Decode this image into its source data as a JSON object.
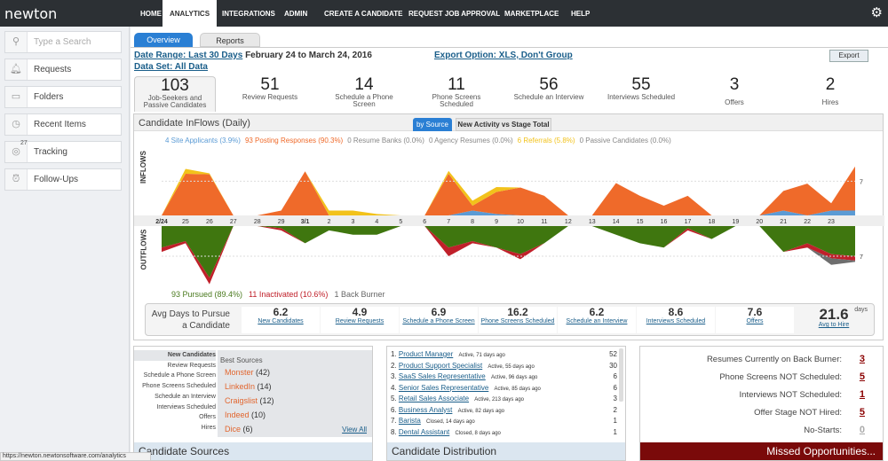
{
  "nav": {
    "logo": "newton",
    "items": [
      "HOME",
      "ANALYTICS",
      "INTEGRATIONS",
      "ADMIN",
      "CREATE A CANDIDATE",
      "REQUEST JOB APPROVAL",
      "MARKETPLACE",
      "HELP"
    ],
    "active": "ANALYTICS"
  },
  "sidebar": {
    "search_placeholder": "Type a Search",
    "items": [
      {
        "label": "Requests",
        "icon": "bell-icon"
      },
      {
        "label": "Folders",
        "icon": "folder-icon"
      },
      {
        "label": "Recent Items",
        "icon": "clock-icon"
      },
      {
        "label": "Tracking",
        "icon": "target-icon",
        "badge": "27"
      },
      {
        "label": "Follow-Ups",
        "icon": "alarm-clock-icon"
      }
    ]
  },
  "tabs": [
    "Overview",
    "Reports"
  ],
  "filters": {
    "date_range_link": "Date Range: Last 30 Days",
    "date_range_text": "February 24 to March 24, 2016",
    "export_option": "Export Option: XLS, Don't Group",
    "data_set": "Data Set: All Data",
    "export_button": "Export"
  },
  "metrics": [
    {
      "value": "103",
      "label": "Job-Seekers and Passive Candidates"
    },
    {
      "value": "51",
      "label": "Review Requests"
    },
    {
      "value": "14",
      "label": "Schedule a Phone Screen"
    },
    {
      "value": "11",
      "label": "Phone Screens Scheduled"
    },
    {
      "value": "56",
      "label": "Schedule an Interview"
    },
    {
      "value": "55",
      "label": "Interviews Scheduled"
    },
    {
      "value": "3",
      "label": "Offers"
    },
    {
      "value": "2",
      "label": "Hires"
    }
  ],
  "chart_panel": {
    "title": "Candidate InFlows (Daily)",
    "tabs": [
      "by Source",
      "New Activity vs Stage Total"
    ],
    "inflow_label": "INFLOWS",
    "outflow_label": "OUTFLOWS"
  },
  "chart_data": {
    "type": "area",
    "x": [
      "2/24",
      "25",
      "26",
      "27",
      "28",
      "29",
      "3/1",
      "2",
      "3",
      "4",
      "5",
      "6",
      "7",
      "8",
      "9",
      "10",
      "11",
      "12",
      "13",
      "14",
      "15",
      "16",
      "17",
      "18",
      "19",
      "20",
      "21",
      "22",
      "23",
      ""
    ],
    "inflows": {
      "reference_value": 7,
      "ylim": [
        0,
        10.5
      ],
      "legend": [
        {
          "label": "4 Site Applicants (3.9%)",
          "color": "#5b9bd5"
        },
        {
          "label": "93 Posting Responses (90.3%)",
          "color": "#ef6a2a"
        },
        {
          "label": "0 Resume Banks (0.0%)",
          "color": "#888888"
        },
        {
          "label": "0 Agency Resumes (0.0%)",
          "color": "#888888"
        },
        {
          "label": "6 Referrals (5.8%)",
          "color": "#f2c21b"
        },
        {
          "label": "0 Passive Candidates (0.0%)",
          "color": "#888888"
        }
      ],
      "series": [
        {
          "name": "Site Applicants",
          "color": "#5b9bd5",
          "values": [
            0,
            0,
            0,
            0,
            0,
            0,
            0,
            0,
            0,
            0,
            0,
            0,
            0,
            1,
            0.3,
            0,
            0,
            0,
            0,
            0,
            0,
            0,
            0,
            0,
            0,
            0,
            1,
            0,
            1,
            1
          ]
        },
        {
          "name": "Posting Responses",
          "color": "#ef6a2a",
          "values": [
            0,
            8.5,
            8.4,
            0,
            0,
            1,
            9,
            0,
            0,
            0,
            0,
            0,
            8.5,
            1,
            4.5,
            5.7,
            4,
            0,
            0,
            6.6,
            4,
            2,
            4,
            0,
            0,
            0,
            4,
            6.5,
            1.5,
            9
          ]
        },
        {
          "name": "Referrals",
          "color": "#f2c21b",
          "values": [
            0,
            1,
            0.2,
            0,
            0,
            0,
            0,
            1,
            1,
            0.3,
            0,
            0,
            0.6,
            1,
            1,
            0,
            0,
            0,
            0,
            0,
            0,
            0,
            0,
            0,
            0,
            0,
            0,
            0,
            0,
            0
          ]
        }
      ]
    },
    "outflows": {
      "reference_value": 7,
      "ylim": [
        0,
        14
      ],
      "legend": [
        {
          "label": "93 Pursued (89.4%)",
          "color": "#4a7a1e"
        },
        {
          "label": "11 Inactivated (10.6%)",
          "color": "#c0202a"
        },
        {
          "label": "1 Back Burner",
          "color": "#666666"
        }
      ],
      "series": [
        {
          "name": "Pursued",
          "color": "#3f760f",
          "values": [
            5,
            3.5,
            12,
            0,
            0,
            0.5,
            4,
            1,
            2,
            2,
            0,
            0,
            5,
            3.5,
            5,
            6.5,
            4,
            0,
            0,
            2,
            4,
            5,
            0.5,
            3,
            0,
            0,
            6,
            4,
            6.5,
            7
          ]
        },
        {
          "name": "Inactivated",
          "color": "#c0202a",
          "values": [
            1,
            0.5,
            1.5,
            0,
            0,
            0.5,
            0,
            0,
            0,
            0,
            0,
            0,
            2,
            0.5,
            0,
            1.2,
            0,
            0,
            0,
            0,
            0,
            0,
            0.5,
            0,
            0,
            0,
            0,
            1,
            1,
            1
          ]
        },
        {
          "name": "Back Burner",
          "color": "#6e6e6e",
          "values": [
            0,
            0,
            0,
            0,
            0,
            0,
            0,
            0,
            0,
            0,
            0,
            0,
            0,
            0,
            0,
            0,
            0,
            0,
            0,
            0,
            0,
            0,
            0,
            0,
            0,
            0,
            0,
            0,
            1.5,
            0.3
          ]
        }
      ]
    }
  },
  "avg_days": {
    "title": "Avg Days to Pursue a Candidate",
    "unit": "days",
    "stages": [
      {
        "value": "6.2",
        "label": "New Candidates"
      },
      {
        "value": "4.9",
        "label": "Review Requests"
      },
      {
        "value": "6.9",
        "label": "Schedule a Phone Screen"
      },
      {
        "value": "16.2",
        "label": "Phone Screens Scheduled"
      },
      {
        "value": "6.2",
        "label": "Schedule an Interview"
      },
      {
        "value": "8.6",
        "label": "Interviews Scheduled"
      },
      {
        "value": "7.6",
        "label": "Offers"
      },
      {
        "value": "21.6",
        "label": "Avg to Hire"
      }
    ]
  },
  "sources": {
    "stages": [
      "New Candidates",
      "Review Requests",
      "Schedule a Phone Screen",
      "Phone Screens Scheduled",
      "Schedule an Interview",
      "Interviews Scheduled",
      "Offers",
      "Hires"
    ],
    "best_title": "Best Sources",
    "best": [
      {
        "name": "Monster",
        "count": "(42)"
      },
      {
        "name": "LinkedIn",
        "count": "(14)"
      },
      {
        "name": "Craigslist",
        "count": "(12)"
      },
      {
        "name": "Indeed",
        "count": "(10)"
      },
      {
        "name": "Dice",
        "count": "(6)"
      }
    ],
    "view_all": "View All",
    "footer": "Candidate Sources"
  },
  "distribution": {
    "jobs": [
      {
        "n": "1.",
        "title": "Product Manager",
        "status": "Active, 71 days ago",
        "count": "52"
      },
      {
        "n": "2.",
        "title": "Product Support Specialist",
        "status": "Active, 55 days ago",
        "count": "30"
      },
      {
        "n": "3.",
        "title": "SaaS Sales Representative",
        "status": "Active, 96 days ago",
        "count": "6"
      },
      {
        "n": "4.",
        "title": "Senior Sales Representative",
        "status": "Active, 85 days ago",
        "count": "6"
      },
      {
        "n": "5.",
        "title": "Retail Sales Associate",
        "status": "Active, 213 days ago",
        "count": "3"
      },
      {
        "n": "6.",
        "title": "Business Analyst",
        "status": "Active, 82 days ago",
        "count": "2"
      },
      {
        "n": "7.",
        "title": "Barista",
        "status": "Closed, 14 days ago",
        "count": "1"
      },
      {
        "n": "8.",
        "title": "Dental Assistant",
        "status": "Closed, 8 days ago",
        "count": "1"
      }
    ],
    "footer": "Candidate Distribution"
  },
  "missed": {
    "rows": [
      {
        "label": "Resumes Currently on Back Burner:",
        "value": "3"
      },
      {
        "label": "Phone Screens NOT Scheduled:",
        "value": "5"
      },
      {
        "label": "Interviews NOT Scheduled:",
        "value": "1"
      },
      {
        "label": "Offer Stage NOT Hired:",
        "value": "5"
      },
      {
        "label": "No-Starts:",
        "value": "0"
      }
    ],
    "footer": "Missed Opportunities..."
  },
  "status_url": "https://newton.newtonsoftware.com/analytics"
}
